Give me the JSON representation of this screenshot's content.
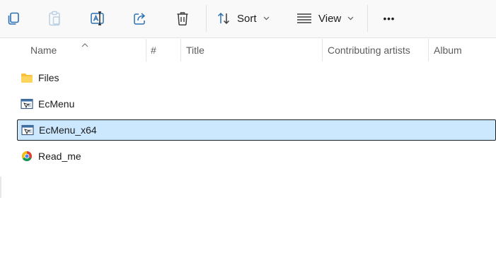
{
  "toolbar": {
    "buttons": [
      {
        "name": "copy-icon"
      },
      {
        "name": "paste-icon"
      },
      {
        "name": "rename-icon"
      },
      {
        "name": "share-icon"
      },
      {
        "name": "delete-icon"
      }
    ],
    "sort_label": "Sort",
    "view_label": "View",
    "more_label": "•••"
  },
  "columns": {
    "name": "Name",
    "number": "#",
    "title": "Title",
    "contributing_artists": "Contributing artists",
    "album": "Album"
  },
  "files": [
    {
      "label": "Files",
      "icon": "folder-icon",
      "selected": false
    },
    {
      "label": "EcMenu",
      "icon": "application-icon",
      "selected": false
    },
    {
      "label": "EcMenu_x64",
      "icon": "application-icon",
      "selected": true
    },
    {
      "label": "Read_me",
      "icon": "chrome-html-icon",
      "selected": false
    }
  ],
  "colors": {
    "selection_bg": "#cce8ff",
    "selection_border": "#1f1f1f",
    "folder": "#f8c33a"
  }
}
